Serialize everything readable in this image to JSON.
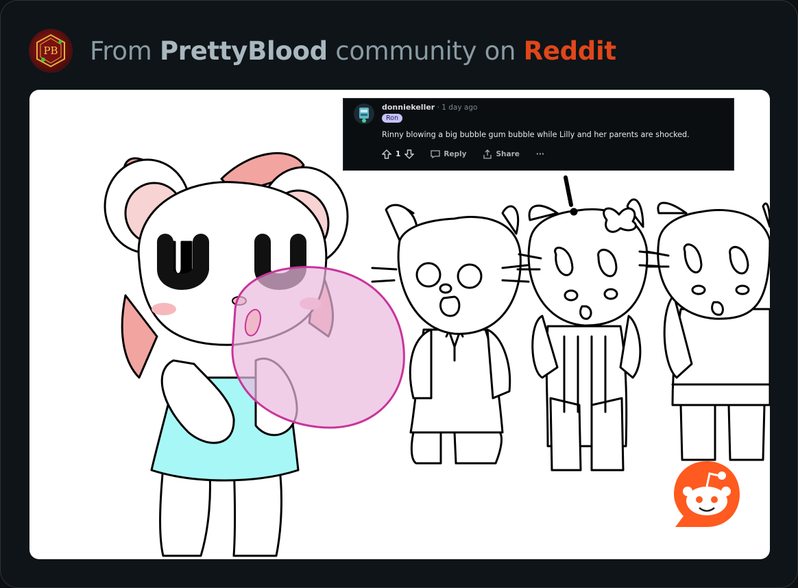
{
  "header": {
    "avatar_text": "PB",
    "prefix": "From ",
    "community": "PrettyBlood",
    "middle": " community on ",
    "brand": "Reddit"
  },
  "comment": {
    "username": "donniekeller",
    "time": " · 1 day ago",
    "flair": "Ron",
    "body": "Rinny blowing a big bubble gum bubble while Lilly and her parents are shocked.",
    "votes": "1",
    "reply_label": "Reply",
    "share_label": "Share",
    "more_label": "···"
  },
  "artwork": {
    "exclamation": "!"
  },
  "colors": {
    "background": "#0e1417",
    "brand": "#e0461b",
    "bubble": "#c8359a",
    "dress": "#a8f7f7",
    "bow": "#f2a4a0"
  },
  "icons": [
    "upvote-icon",
    "downvote-icon",
    "reply-icon",
    "share-icon",
    "reddit-snoo-icon"
  ]
}
